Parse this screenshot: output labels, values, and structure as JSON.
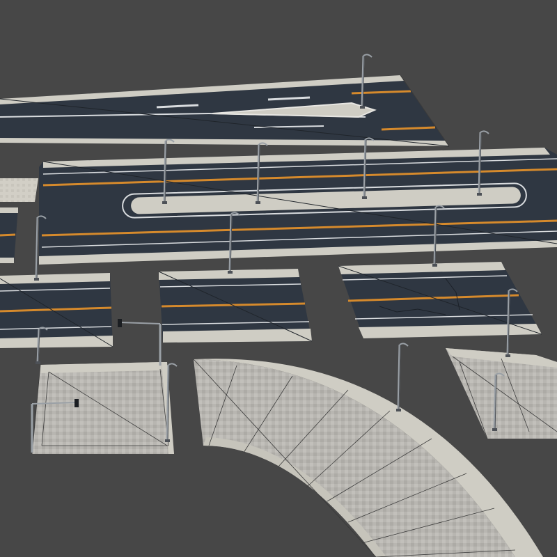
{
  "viewport": {
    "background": "#474747"
  },
  "palette": {
    "asphalt": "#2f3742",
    "asphalt_dark": "#27303a",
    "curb": "#cfcdc4",
    "curb_dark": "#9e9c94",
    "lane_white": "#d9dcdf",
    "lane_yellow": "#d68a2c",
    "paving": "#b9b7b2",
    "paving_dark": "#a9a7a2",
    "wireframe": "#3a3a3a",
    "pole": "#9aa0a6",
    "pole_dark": "#4d5157"
  },
  "assets": [
    {
      "name": "road-tile-merge-island",
      "kind": "road",
      "has_median": true
    },
    {
      "name": "road-tile-long-median",
      "kind": "road",
      "has_median": true
    },
    {
      "name": "road-tile-small-left",
      "kind": "road",
      "has_median": false
    },
    {
      "name": "road-tile-center",
      "kind": "road",
      "has_median": false
    },
    {
      "name": "road-tile-right-cracked",
      "kind": "road",
      "has_median": false
    },
    {
      "name": "sidewalk-tile-corner",
      "kind": "sidewalk"
    },
    {
      "name": "sidewalk-tile-curved",
      "kind": "sidewalk"
    },
    {
      "name": "sidewalk-tile-right",
      "kind": "sidewalk"
    },
    {
      "name": "concrete-tile-small",
      "kind": "concrete"
    }
  ],
  "props": {
    "street_lamp_count": 13,
    "traffic_light_count": 2
  }
}
